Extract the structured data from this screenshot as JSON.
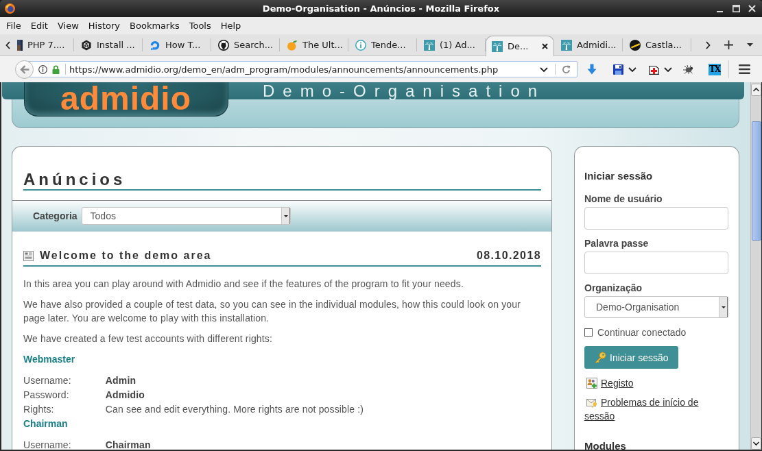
{
  "window": {
    "title": "Demo-Organisation - Anúncios - Mozilla Firefox"
  },
  "menu_bar": [
    "File",
    "Edit",
    "View",
    "History",
    "Bookmarks",
    "Tools",
    "Help"
  ],
  "tabs": [
    {
      "label": "PHP 7....",
      "selected": false
    },
    {
      "label": "Install ...",
      "selected": false
    },
    {
      "label": "How T...",
      "selected": false
    },
    {
      "label": "Search...",
      "selected": false
    },
    {
      "label": "The Ult...",
      "selected": false
    },
    {
      "label": "Tende...",
      "selected": false
    },
    {
      "label": "(1) Ad...",
      "selected": false
    },
    {
      "label": "De...",
      "selected": true
    },
    {
      "label": "Admidi...",
      "selected": false
    },
    {
      "label": "Castla...",
      "selected": false
    }
  ],
  "nav_bar": {
    "url": "https://www.admidio.org/demo_en/adm_program/modules/announcements/announcements.php",
    "extension_label": "TX"
  },
  "page": {
    "header": {
      "logo": "admidio",
      "organization": "Demo-Organisation"
    },
    "main": {
      "title": "Anúncios",
      "filter": {
        "label": "Categoria",
        "value": "Todos"
      },
      "announcement": {
        "title": "Welcome to the demo area",
        "date": "08.10.2018",
        "paragraphs": [
          "In this area you can play around with Admidio and see if the features of the program to fit your needs.",
          "We have also provided a couple of test data, so you can see in the individual modules, how this could look on your page later. You are welcome to play with this installation.",
          "We have created a few test accounts with different rights:"
        ],
        "accounts": [
          {
            "role": "Webmaster",
            "fields": [
              {
                "label": "Username:",
                "value": "Admin",
                "bold": true
              },
              {
                "label": "Password:",
                "value": "Admidio",
                "bold": true
              },
              {
                "label": "Rights:",
                "value": "Can see and edit everything. More rights are not possible :)",
                "bold": false
              }
            ]
          },
          {
            "role": "Chairman",
            "fields": [
              {
                "label": "Username:",
                "value": "Chairman",
                "bold": true
              }
            ]
          }
        ]
      }
    },
    "sidebar": {
      "title": "Iniciar sessão",
      "fields": [
        {
          "label": "Nome de usuário",
          "kind": "text"
        },
        {
          "label": "Palavra passe",
          "kind": "password"
        },
        {
          "label": "Organização",
          "kind": "select",
          "value": "Demo-Organisation"
        }
      ],
      "remember": {
        "label": "Continuar conectado",
        "checked": false
      },
      "submit": "Iniciar sessão",
      "links": [
        "Registo",
        "Problemas de início de sessão"
      ],
      "next_heading": "Modules"
    }
  }
}
